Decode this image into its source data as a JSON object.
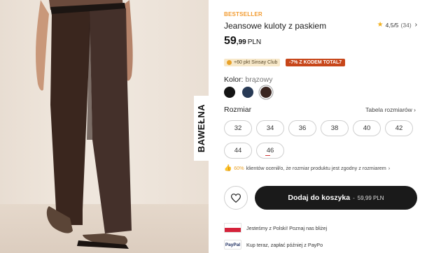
{
  "photo": {
    "badge": "BAWEŁNA"
  },
  "product": {
    "badge": "BESTSELLER",
    "title": "Jeansowe kuloty z paskiem",
    "price_main": "59",
    "price_cents": ",99",
    "currency": "PLN",
    "rating": "4,5/5",
    "reviews": "(34)"
  },
  "promos": {
    "club": "+60 pkt Sinsay Club",
    "code": "-7% Z KODEM TOTAL7"
  },
  "color": {
    "label": "Kolor:",
    "value": "brązowy",
    "swatches": [
      "#141414",
      "#283a55",
      "#3a2620"
    ]
  },
  "size": {
    "label": "Rozmiar",
    "table_link": "Tabela rozmiarów",
    "options": [
      "32",
      "34",
      "36",
      "38",
      "40",
      "42",
      "44",
      "46"
    ]
  },
  "fit": {
    "percent": "60%",
    "text": "klientów ocenił/o, że rozmiar produktu jest zgodny z rozmiarem"
  },
  "cart": {
    "label": "Dodaj do koszyka",
    "separator": "-",
    "price": "59,99 PLN"
  },
  "info": {
    "poland": "Jesteśmy z Polski! Poznaj nas bliżej",
    "paypal_logo": "PayPal",
    "paypal": "Kup teraz, zapłać później z PayPo"
  }
}
